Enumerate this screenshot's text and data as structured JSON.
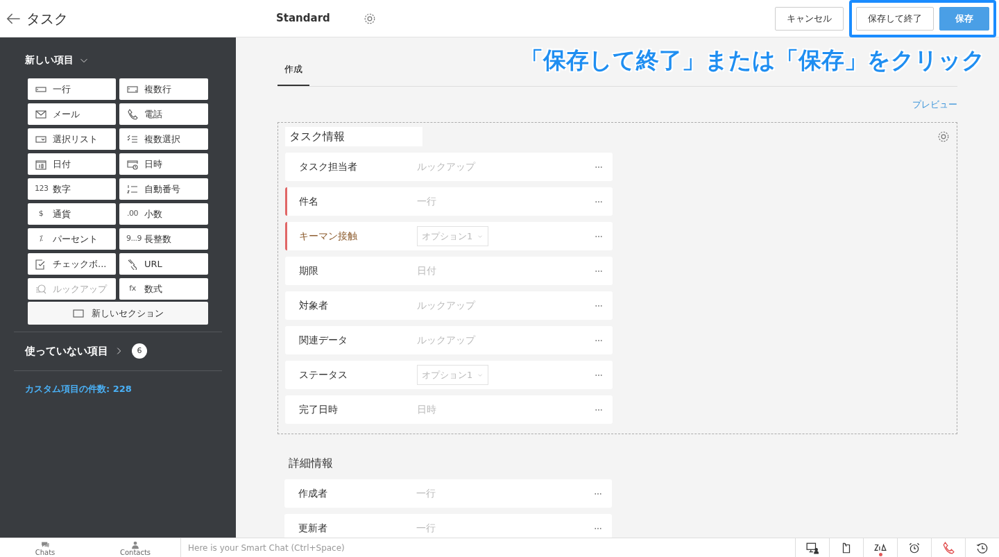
{
  "header": {
    "title": "タスク",
    "layout_name": "Standard",
    "buttons": [
      {
        "label": "キャンセル",
        "kind": "secondary"
      },
      {
        "label": "保存して終了",
        "kind": "secondary"
      },
      {
        "label": "保存",
        "kind": "primary"
      }
    ]
  },
  "annotation": {
    "caption": "「保存して終了」または「保存」をクリック"
  },
  "sidebar": {
    "heading": "新しい項目",
    "items": [
      {
        "label": "一行",
        "kind": "singleline",
        "disabled": false
      },
      {
        "label": "複数行",
        "kind": "multiline",
        "disabled": false
      },
      {
        "label": "メール",
        "kind": "mail",
        "disabled": false
      },
      {
        "label": "電話",
        "kind": "phone",
        "disabled": false
      },
      {
        "label": "選択リスト",
        "kind": "picklist",
        "disabled": false
      },
      {
        "label": "複数選択",
        "kind": "checklist",
        "disabled": false
      },
      {
        "label": "日付",
        "kind": "calendar",
        "disabled": false
      },
      {
        "label": "日時",
        "kind": "datetime",
        "disabled": false
      },
      {
        "label": "数字",
        "kind": "glyph",
        "glyph": "123",
        "disabled": false
      },
      {
        "label": "自動番号",
        "kind": "numbered",
        "disabled": false
      },
      {
        "label": "通貨",
        "kind": "glyph",
        "glyph": "$",
        "disabled": false
      },
      {
        "label": "小数",
        "kind": "glyph",
        "glyph": ".00",
        "disabled": false
      },
      {
        "label": "パーセント",
        "kind": "glyph",
        "glyph": "⁒",
        "disabled": false
      },
      {
        "label": "長整数",
        "kind": "glyph",
        "glyph": "9...9",
        "disabled": false
      },
      {
        "label": "チェックボ...",
        "kind": "checkbox",
        "disabled": false
      },
      {
        "label": "URL",
        "kind": "link",
        "disabled": false
      },
      {
        "label": "ルックアップ",
        "kind": "lookup",
        "disabled": true
      },
      {
        "label": "数式",
        "kind": "glyph",
        "glyph": "fx",
        "disabled": false
      }
    ],
    "new_section": "新しいセクション",
    "unused": {
      "label": "使っていない項目",
      "count": "6"
    },
    "custom_count": "カスタム項目の件数: 228"
  },
  "tabs": [
    {
      "label": "作成",
      "selected": true
    }
  ],
  "preview_link": "プレビュー",
  "sections": [
    {
      "title": "タスク情報",
      "kind": "panel",
      "fields": [
        {
          "label": "タスク担当者",
          "kind": "text",
          "value": "ルックアップ",
          "mandatory": false,
          "highlighted": false
        },
        {
          "label": "件名",
          "kind": "text",
          "value": "一行",
          "mandatory": true,
          "highlighted": false
        },
        {
          "label": "キーマン接触",
          "kind": "select",
          "value": "オプション1",
          "mandatory": true,
          "highlighted": true
        },
        {
          "label": "期限",
          "kind": "text",
          "value": "日付",
          "mandatory": false,
          "highlighted": false
        },
        {
          "label": "対象者",
          "kind": "text",
          "value": "ルックアップ",
          "mandatory": false,
          "highlighted": false
        },
        {
          "label": "関連データ",
          "kind": "text",
          "value": "ルックアップ",
          "mandatory": false,
          "highlighted": false
        },
        {
          "label": "ステータス",
          "kind": "select",
          "value": "オプション1",
          "mandatory": false,
          "highlighted": false
        },
        {
          "label": "完了日時",
          "kind": "text",
          "value": "日時",
          "mandatory": false,
          "highlighted": false
        }
      ]
    },
    {
      "title": "詳細情報",
      "kind": "plain",
      "fields": [
        {
          "label": "作成者",
          "kind": "text",
          "value": "一行",
          "mandatory": false,
          "highlighted": false
        },
        {
          "label": "更新者",
          "kind": "text",
          "value": "一行",
          "mandatory": false,
          "highlighted": false
        }
      ]
    }
  ],
  "bottom_bar": {
    "tabs": [
      {
        "label": "Chats",
        "kind": "chat"
      },
      {
        "label": "Contacts",
        "kind": "person"
      }
    ],
    "chat_placeholder": "Here is your Smart Chat (Ctrl+Space)",
    "tools": [
      {
        "kind": "screen",
        "notification": false,
        "alert": false
      },
      {
        "kind": "note",
        "notification": false,
        "alert": false
      },
      {
        "kind": "zia",
        "notification": true,
        "alert": false
      },
      {
        "kind": "alarm",
        "notification": false,
        "alert": false
      },
      {
        "kind": "phone",
        "notification": false,
        "alert": true
      },
      {
        "kind": "history",
        "notification": false,
        "alert": false
      }
    ]
  }
}
